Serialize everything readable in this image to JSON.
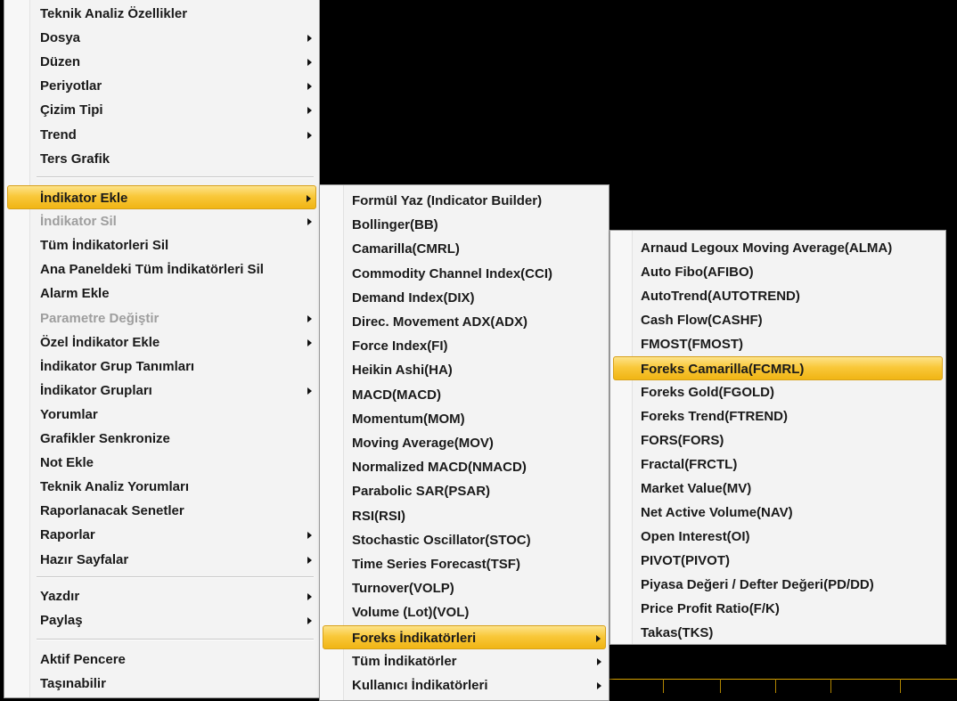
{
  "main_menu": {
    "items": [
      {
        "label": "Teknik Analiz Özellikler"
      },
      {
        "label": "Dosya",
        "submenu": true
      },
      {
        "label": "Düzen",
        "submenu": true
      },
      {
        "label": "Periyotlar",
        "submenu": true
      },
      {
        "label": "Çizim Tipi",
        "submenu": true
      },
      {
        "label": "Trend",
        "submenu": true
      },
      {
        "label": "Ters Grafik"
      },
      {
        "label": "İndikator Ekle",
        "submenu": true,
        "highlighted": true
      },
      {
        "label": "İndikator Sil",
        "submenu": true,
        "disabled": true
      },
      {
        "label": "Tüm İndikatorleri Sil"
      },
      {
        "label": "Ana Paneldeki Tüm İndikatörleri Sil"
      },
      {
        "label": "Alarm Ekle"
      },
      {
        "label": "Parametre Değiştir",
        "submenu": true,
        "disabled": true
      },
      {
        "label": "Özel İndikator Ekle",
        "submenu": true
      },
      {
        "label": "İndikator Grup Tanımları"
      },
      {
        "label": "İndikator Grupları",
        "submenu": true
      },
      {
        "label": "Yorumlar"
      },
      {
        "label": "Grafikler Senkronize"
      },
      {
        "label": "Not Ekle"
      },
      {
        "label": "Teknik Analiz Yorumları"
      },
      {
        "label": "Raporlanacak Senetler"
      },
      {
        "label": "Raporlar",
        "submenu": true
      },
      {
        "label": "Hazır Sayfalar",
        "submenu": true
      },
      {
        "label": "Yazdır",
        "submenu": true
      },
      {
        "label": "Paylaş",
        "submenu": true
      },
      {
        "label": "Aktif Pencere"
      },
      {
        "label": "Taşınabilir"
      }
    ]
  },
  "indicator_menu": {
    "items": [
      {
        "label": "Formül Yaz (Indicator Builder)"
      },
      {
        "label": "Bollinger(BB)"
      },
      {
        "label": "Camarilla(CMRL)"
      },
      {
        "label": "Commodity Channel Index(CCI)"
      },
      {
        "label": "Demand Index(DIX)"
      },
      {
        "label": "Direc. Movement ADX(ADX)"
      },
      {
        "label": "Force Index(FI)"
      },
      {
        "label": "Heikin Ashi(HA)"
      },
      {
        "label": "MACD(MACD)"
      },
      {
        "label": "Momentum(MOM)"
      },
      {
        "label": "Moving Average(MOV)"
      },
      {
        "label": "Normalized MACD(NMACD)"
      },
      {
        "label": "Parabolic SAR(PSAR)"
      },
      {
        "label": "RSI(RSI)"
      },
      {
        "label": "Stochastic Oscillator(STOC)"
      },
      {
        "label": "Time Series Forecast(TSF)"
      },
      {
        "label": "Turnover(VOLP)"
      },
      {
        "label": "Volume (Lot)(VOL)"
      },
      {
        "label": "Foreks İndikatörleri",
        "submenu": true,
        "highlighted": true
      },
      {
        "label": "Tüm İndikatörler",
        "submenu": true
      },
      {
        "label": "Kullanıcı İndikatörleri",
        "submenu": true
      }
    ]
  },
  "foreks_menu": {
    "items": [
      {
        "label": "Arnaud Legoux Moving Average(ALMA)"
      },
      {
        "label": "Auto Fibo(AFIBO)"
      },
      {
        "label": "AutoTrend(AUTOTREND)"
      },
      {
        "label": "Cash Flow(CASHF)"
      },
      {
        "label": "FMOST(FMOST)"
      },
      {
        "label": "Foreks Camarilla(FCMRL)",
        "highlighted": true
      },
      {
        "label": "Foreks Gold(FGOLD)"
      },
      {
        "label": "Foreks Trend(FTREND)"
      },
      {
        "label": "FORS(FORS)"
      },
      {
        "label": "Fractal(FRCTL)"
      },
      {
        "label": "Market Value(MV)"
      },
      {
        "label": "Net Active Volume(NAV)"
      },
      {
        "label": "Open Interest(OI)"
      },
      {
        "label": "PIVOT(PIVOT)"
      },
      {
        "label": "Piyasa Değeri / Defter Değeri(PD/DD)"
      },
      {
        "label": "Price Profit Ratio(F/K)"
      },
      {
        "label": "Takas(TKS)"
      }
    ]
  },
  "colors": {
    "background": "#000000",
    "menu_bg": "#f3f3f3",
    "highlight": "#f9c83a",
    "disabled_text": "#9e9e9e",
    "chart_line": "#d9a300"
  }
}
